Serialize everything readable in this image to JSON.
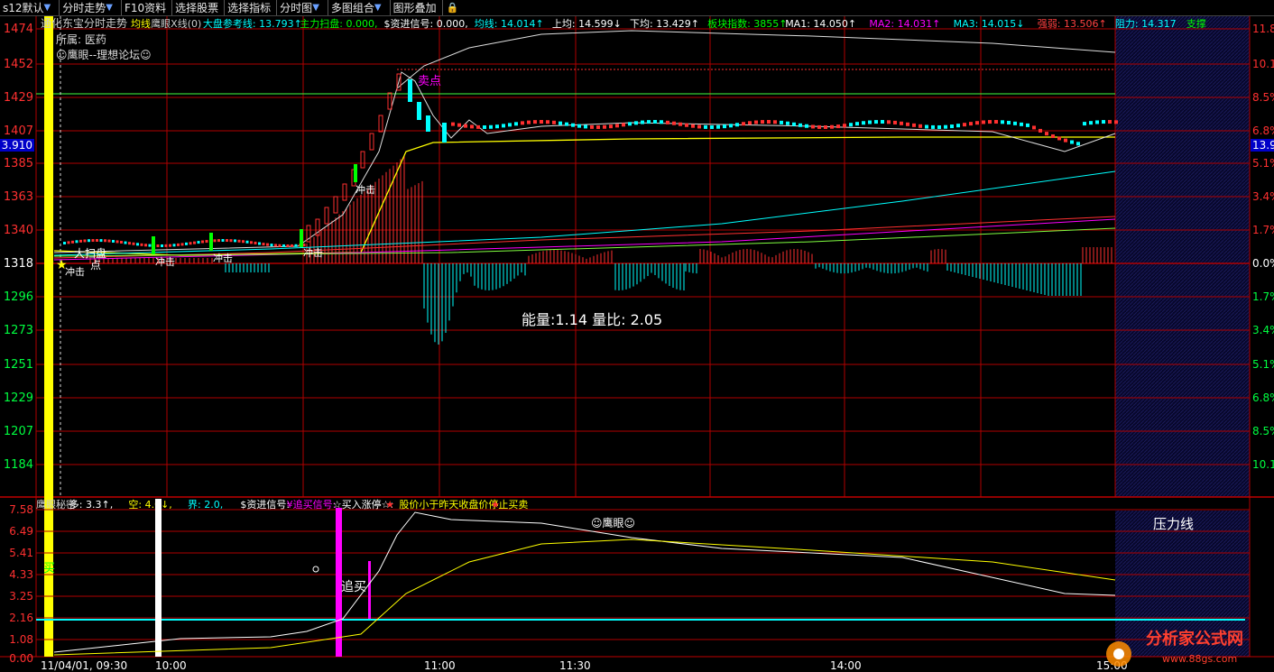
{
  "toolbar": {
    "items": [
      {
        "label": "s12默认",
        "arrow": true
      },
      {
        "label": "分时走势",
        "arrow": true
      },
      {
        "label": "F10资料",
        "arrow": false
      },
      {
        "label": "选择股票",
        "arrow": false
      },
      {
        "label": "选择指标",
        "arrow": false
      },
      {
        "label": "分时图",
        "arrow": true
      },
      {
        "label": "多图组合",
        "arrow": true
      },
      {
        "label": "图形叠加",
        "arrow": false
      }
    ],
    "lock_icon": "lock-icon"
  },
  "main_panel": {
    "title": "通化东宝分时走势",
    "indicator_line": [
      {
        "text": "均线",
        "color": "#ffff00"
      },
      {
        "text": "鹰眼X线(0)",
        "color": "#cccccc"
      },
      {
        "text": "大盘参考线: 13.793↑",
        "color": "#00ffff"
      },
      {
        "text": "主力扫盘: 0.000,",
        "color": "#00ff00"
      },
      {
        "text": "$资进信号: 0.000,",
        "color": "#ffffff"
      },
      {
        "text": "均线: 14.014↑",
        "color": "#00ffff"
      },
      {
        "text": "上均: 14.599↓",
        "color": "#ffffff"
      },
      {
        "text": "下均: 13.429↑",
        "color": "#ffffff"
      },
      {
        "text": "板块指数: 3855↑",
        "color": "#00ff00"
      },
      {
        "text": "MA1: 14.050↑",
        "color": "#ffffff"
      },
      {
        "text": "MA2: 14.031↑",
        "color": "#ff00ff"
      },
      {
        "text": "MA3: 14.015↓",
        "color": "#00ffff"
      },
      {
        "text": "强弱: 13.506↑",
        "color": "#ff4040"
      },
      {
        "text": "阻力: 14.317",
        "color": "#00ffff"
      },
      {
        "text": "支撑",
        "color": "#00ff00"
      }
    ],
    "sector_line": "所属: 医药",
    "forum_line": "☺鹰眼--理想论坛☺",
    "left_axis": [
      "1474",
      "1452",
      "1429",
      "1407",
      "1385",
      "1363",
      "1340",
      "1318",
      "1296",
      "1273",
      "1251",
      "1229",
      "1207",
      "1184"
    ],
    "right_axis": [
      "11.8",
      "10.1%",
      "8.5%",
      "6.8%",
      "5.1%",
      "3.4%",
      "1.7%",
      "0.0%",
      "1.7%",
      "3.4%",
      "5.1%",
      "6.8%",
      "8.5%",
      "10.1%"
    ],
    "left_price_tag": "3.910",
    "right_price_tag": "13.9",
    "labels": {
      "sell_point": "卖点",
      "chongji": "冲击",
      "sao_pan": "大扫盘",
      "buy_point": "点"
    },
    "energy": "能量:1.14  量比: 2.05"
  },
  "sub_panel": {
    "indicator_line": [
      {
        "text": "鹰眼秘密",
        "color": "#cccccc"
      },
      {
        "text": "多: 3.3↑,",
        "color": "#ffffff"
      },
      {
        "text": "空: 4.0↓,",
        "color": "#ffff00"
      },
      {
        "text": "界: 2.0,",
        "color": "#00ffff"
      },
      {
        "text": "$资进信号:",
        "color": "#ffffff"
      },
      {
        "text": "¥追买信号:",
        "color": "#ff00ff"
      },
      {
        "text": "☆买入涨停☆:",
        "color": "#ffffff"
      },
      {
        "text": "★",
        "color": "#ff3030"
      },
      {
        "text": "股价小于昨天收盘价停止买卖",
        "color": "#ffff00"
      },
      {
        "text": "★",
        "color": "#ff3030"
      }
    ],
    "left_axis": [
      "7.58",
      "6.49",
      "5.41",
      "4.33",
      "3.25",
      "2.16",
      "1.08",
      "0.00"
    ],
    "pressure_label": "压力线",
    "eagle_label": "☺鹰眼☺",
    "zhui_mai": "追买",
    "buy_char": "买"
  },
  "time_axis": [
    "11/04/01, 09:30",
    "10:00",
    "11:00",
    "11:30",
    "14:00",
    "15:00"
  ],
  "watermark": {
    "title": "分析家公式网",
    "url": "www.88gs.com"
  },
  "colors": {
    "up": "#ff3030",
    "down": "#00ffff",
    "grid": "#b00000",
    "yellow": "#ffff00",
    "magenta": "#ff00ff"
  }
}
